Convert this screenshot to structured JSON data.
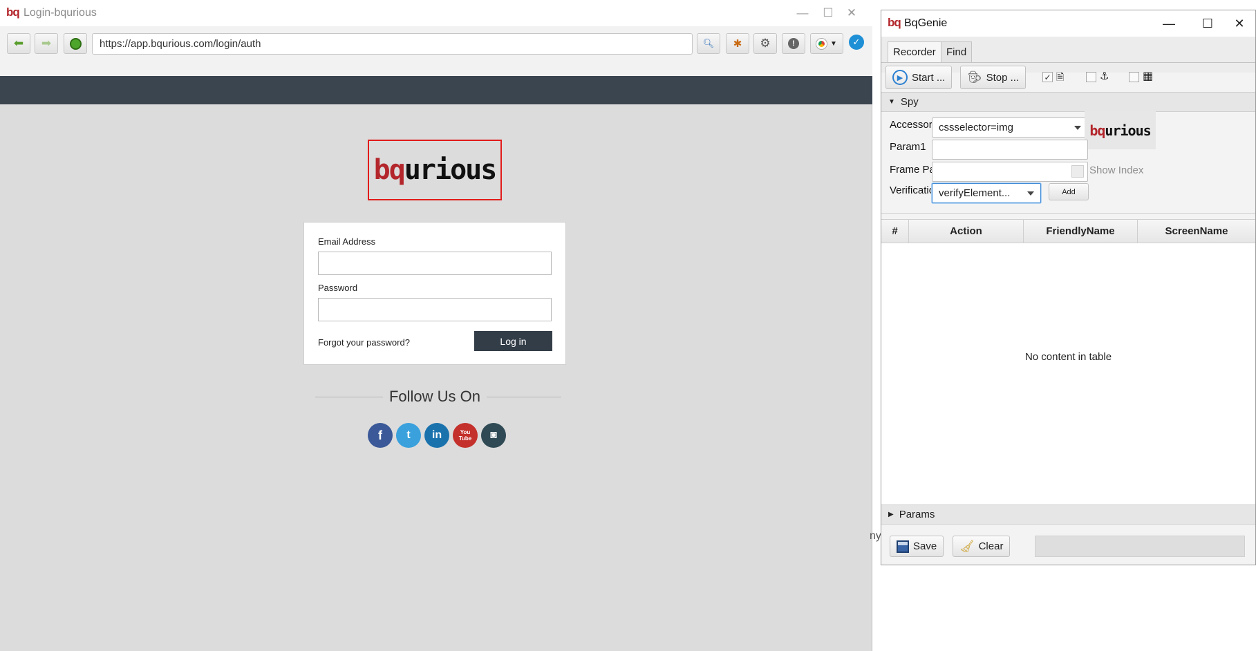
{
  "browser": {
    "title": "Login-bqurious",
    "logo_text": "bq",
    "url": "https://app.bqurious.com/login/auth",
    "window_controls": {
      "minimize": "—",
      "maximize": "☐",
      "close": "✕"
    },
    "toolbar_icons": [
      "back-arrow-icon",
      "forward-arrow-icon",
      "refresh-icon",
      "search-icon",
      "bug-icon",
      "gear-icon",
      "info-icon",
      "chrome-icon",
      "checkmark-icon"
    ]
  },
  "page": {
    "logo": {
      "red_part": "bq",
      "black_part": "urious"
    },
    "login": {
      "email_label": "Email Address",
      "password_label": "Password",
      "forgot_link": "Forgot your password?",
      "login_button": "Log in"
    },
    "follow_title": "Follow Us On",
    "social": [
      {
        "name": "facebook-icon",
        "glyph": "f",
        "color": "#3b5998"
      },
      {
        "name": "twitter-icon",
        "glyph": "t",
        "color": "#3aa1dc"
      },
      {
        "name": "linkedin-icon",
        "glyph": "in",
        "color": "#1a72ad"
      },
      {
        "name": "youtube-icon",
        "glyph": "You Tube",
        "color": "#c4302b"
      },
      {
        "name": "slideshare-icon",
        "glyph": "◙",
        "color": "#2f4a55"
      }
    ]
  },
  "genie": {
    "title": "BqGenie",
    "logo_text": "bq",
    "window_controls": {
      "minimize": "—",
      "maximize": "☐",
      "close": "✕"
    },
    "tabs": [
      {
        "label": "Recorder",
        "active": true
      },
      {
        "label": "Find",
        "active": false
      }
    ],
    "start_button": "Start ...",
    "stop_button": "Stop ...",
    "spy_title": "Spy",
    "accessor_label": "Accessor",
    "accessor_value": "cssselector=img",
    "param1_label": "Param1",
    "param1_value": "",
    "frame_path_label": "Frame Path",
    "frame_path_value": "",
    "show_index_label": "Show Index",
    "verification_label": "Verification",
    "verification_value": "verifyElement...",
    "add_button": "Add",
    "preview_logo": {
      "red_part": "bq",
      "black_part": "urious"
    },
    "table_headers": [
      "#",
      "Action",
      "FriendlyName",
      "ScreenName"
    ],
    "empty_message": "No content in table",
    "params_title": "Params",
    "save_button": "Save",
    "clear_button": "Clear"
  },
  "background_text": "ny"
}
